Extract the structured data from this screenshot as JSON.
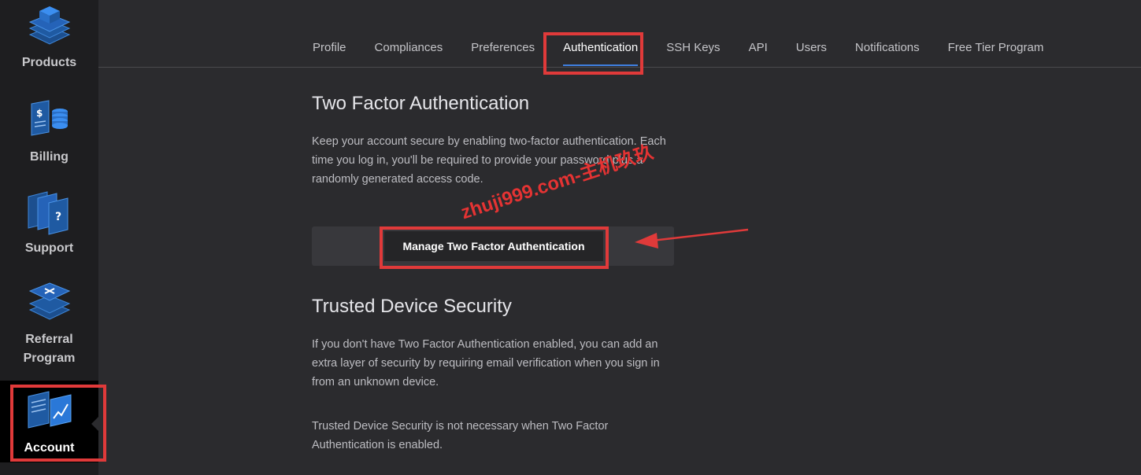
{
  "sidebar": {
    "items": [
      {
        "label": "Products",
        "icon": "layers-icon"
      },
      {
        "label": "Billing",
        "icon": "billing-icon"
      },
      {
        "label": "Support",
        "icon": "support-icon"
      },
      {
        "label": "Referral Program",
        "icon": "referral-icon"
      },
      {
        "label": "Account",
        "icon": "account-icon",
        "active": true
      }
    ]
  },
  "tabs": [
    {
      "label": "Profile"
    },
    {
      "label": "Compliances"
    },
    {
      "label": "Preferences"
    },
    {
      "label": "Authentication",
      "active": true
    },
    {
      "label": "SSH Keys"
    },
    {
      "label": "API"
    },
    {
      "label": "Users"
    },
    {
      "label": "Notifications"
    },
    {
      "label": "Free Tier Program"
    }
  ],
  "two_factor": {
    "title": "Two Factor Authentication",
    "description": "Keep your account secure by enabling two-factor authentication. Each time you log in, you'll be required to provide your password plus a randomly generated access code.",
    "button_label": "Manage Two Factor Authentication"
  },
  "trusted_device": {
    "title": "Trusted Device Security",
    "description": "If you don't have Two Factor Authentication enabled, you can add an extra layer of security by requiring email verification when you sign in from an unknown device.",
    "note": "Trusted Device Security is not necessary when Two Factor Authentication is enabled."
  },
  "watermark": "zhuji999.com-主机玖玖",
  "colors": {
    "highlight": "#e03a3a",
    "accent": "#3f7fe0",
    "background": "#2b2b2e",
    "sidebar": "#1e1e20"
  }
}
